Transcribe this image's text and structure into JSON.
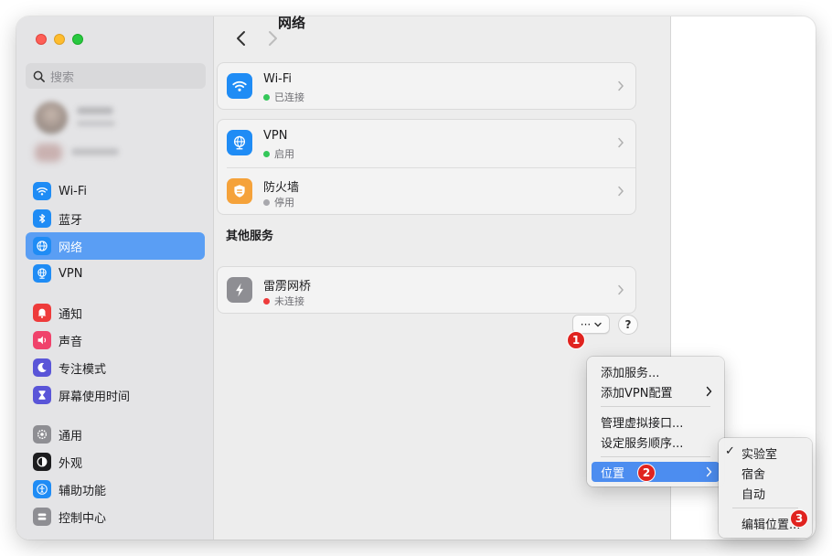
{
  "window": {
    "title": "网络"
  },
  "sidebar": {
    "search_placeholder": "搜索",
    "items": [
      {
        "label": "Wi-Fi",
        "icon": "wifi-icon",
        "color": "#1f8cf5"
      },
      {
        "label": "蓝牙",
        "icon": "bluetooth-icon",
        "color": "#1f8cf5"
      },
      {
        "label": "网络",
        "icon": "globe-icon",
        "color": "#1f8cf5",
        "active": true
      },
      {
        "label": "VPN",
        "icon": "vpn-globe-icon",
        "color": "#1f8cf5"
      },
      {
        "label": "通知",
        "icon": "bell-icon",
        "color": "#ee3b3b"
      },
      {
        "label": "声音",
        "icon": "speaker-icon",
        "color": "#f0426b"
      },
      {
        "label": "专注模式",
        "icon": "moon-icon",
        "color": "#5a55d8"
      },
      {
        "label": "屏幕使用时间",
        "icon": "hourglass-icon",
        "color": "#5a55d8"
      },
      {
        "label": "通用",
        "icon": "gear-icon",
        "color": "#8e8e93"
      },
      {
        "label": "外观",
        "icon": "appearance-icon",
        "color": "#1d1d1f"
      },
      {
        "label": "辅助功能",
        "icon": "accessibility-icon",
        "color": "#1f8cf5"
      },
      {
        "label": "控制中心",
        "icon": "control-center-icon",
        "color": "#8e8e93"
      }
    ]
  },
  "services": {
    "wifi": {
      "title": "Wi-Fi",
      "status": "已连接",
      "status_color": "#34c759",
      "icon_color": "#1f8cf5"
    },
    "vpn": {
      "title": "VPN",
      "status": "启用",
      "status_color": "#34c759",
      "icon_color": "#1f8cf5"
    },
    "firewall": {
      "title": "防火墙",
      "status": "停用",
      "status_color": "#a8a8ad",
      "icon_color": "#f5a23a"
    },
    "other_title": "其他服务",
    "thunderbolt": {
      "title": "雷雳网桥",
      "status": "未连接",
      "status_color": "#ee3b3b",
      "icon_color": "#8e8e93"
    }
  },
  "toolbar": {
    "more_label": "···",
    "help_label": "?"
  },
  "badges": {
    "b1": "1",
    "b2": "2",
    "b3": "3"
  },
  "action_menu": {
    "items": [
      "添加服务...",
      "添加VPN配置",
      "管理虚拟接口...",
      "设定服务顺序...",
      "位置"
    ]
  },
  "location_menu": {
    "checked": "✓",
    "items": [
      "实验室",
      "宿舍",
      "自动",
      "编辑位置..."
    ]
  },
  "colors": {
    "accent": "#5a9ef4",
    "highlight": "#4c8df0",
    "badge": "#e0231f"
  }
}
